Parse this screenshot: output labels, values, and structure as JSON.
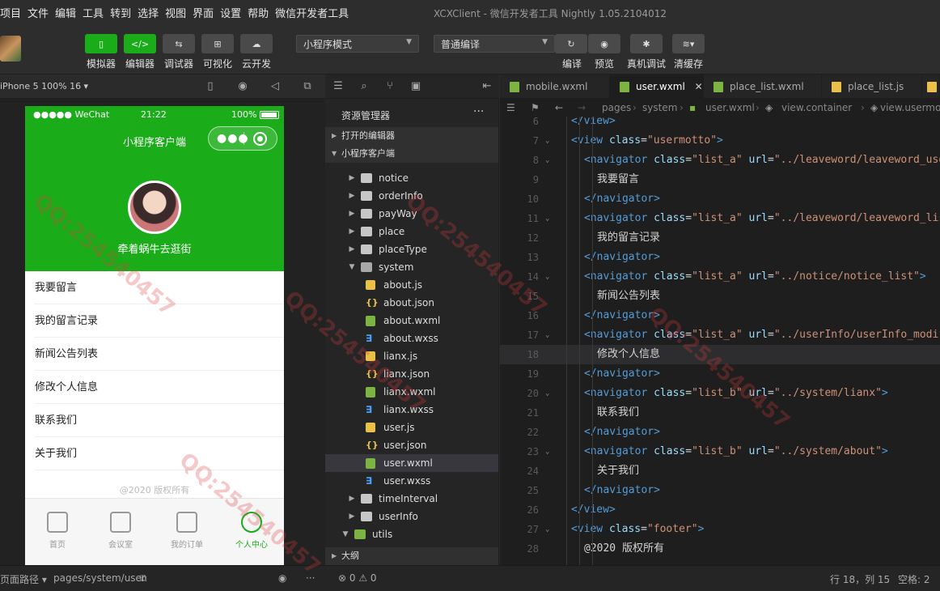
{
  "menubar": {
    "items": [
      "项目",
      "文件",
      "编辑",
      "工具",
      "转到",
      "选择",
      "视图",
      "界面",
      "设置",
      "帮助",
      "微信开发者工具"
    ],
    "title": "XCXClient - 微信开发者工具 Nightly 1.05.2104012"
  },
  "toolbar": {
    "buttons": [
      {
        "label": "模拟器",
        "icon": "phone-icon"
      },
      {
        "label": "编辑器",
        "icon": "code-icon"
      },
      {
        "label": "调试器",
        "icon": "debug-icon"
      },
      {
        "label": "可视化",
        "icon": "layout-icon"
      },
      {
        "label": "云开发",
        "icon": "cloud-icon"
      }
    ],
    "mode_select": "小程序模式",
    "compile_select": "普通编译",
    "right_buttons": [
      {
        "label": "编译",
        "icon": "refresh-icon"
      },
      {
        "label": "预览",
        "icon": "eye-icon"
      },
      {
        "label": "真机调试",
        "icon": "bug-icon"
      },
      {
        "label": "清缓存",
        "icon": "layers-icon"
      }
    ]
  },
  "simulator": {
    "device": "iPhone 5 100% 16 ▾",
    "status": {
      "carrier": "●●●●● WeChat",
      "time": "21:22",
      "battery": "100%"
    },
    "nav_title": "小程序客户端",
    "username": "牵着蜗牛去逛街",
    "menu_items": [
      "我要留言",
      "我的留言记录",
      "新闻公告列表",
      "修改个人信息",
      "联系我们",
      "关于我们"
    ],
    "footer": "@2020 版权所有",
    "tabs": [
      {
        "label": "首页",
        "active": false
      },
      {
        "label": "会议室",
        "active": false
      },
      {
        "label": "我的订单",
        "active": false
      },
      {
        "label": "个人中心",
        "active": true
      }
    ]
  },
  "explorer": {
    "title": "资源管理器",
    "open_editors": "打开的编辑器",
    "project": "小程序客户端",
    "outline": "大纲",
    "tree": [
      {
        "name": "notice",
        "type": "folder",
        "level": 1
      },
      {
        "name": "orderInfo",
        "type": "folder",
        "level": 1
      },
      {
        "name": "payWay",
        "type": "folder",
        "level": 1
      },
      {
        "name": "place",
        "type": "folder",
        "level": 1
      },
      {
        "name": "placeType",
        "type": "folder",
        "level": 1
      },
      {
        "name": "system",
        "type": "folder-open",
        "level": 1
      },
      {
        "name": "about.js",
        "type": "js",
        "level": 2
      },
      {
        "name": "about.json",
        "type": "json",
        "level": 2
      },
      {
        "name": "about.wxml",
        "type": "wxml",
        "level": 2
      },
      {
        "name": "about.wxss",
        "type": "wxss",
        "level": 2
      },
      {
        "name": "lianx.js",
        "type": "js",
        "level": 2
      },
      {
        "name": "lianx.json",
        "type": "json",
        "level": 2
      },
      {
        "name": "lianx.wxml",
        "type": "wxml",
        "level": 2
      },
      {
        "name": "lianx.wxss",
        "type": "wxss",
        "level": 2
      },
      {
        "name": "user.js",
        "type": "js",
        "level": 2
      },
      {
        "name": "user.json",
        "type": "json",
        "level": 2
      },
      {
        "name": "user.wxml",
        "type": "wxml",
        "level": 2,
        "selected": true
      },
      {
        "name": "user.wxss",
        "type": "wxss",
        "level": 2
      },
      {
        "name": "timeInterval",
        "type": "folder",
        "level": 1
      },
      {
        "name": "userInfo",
        "type": "folder",
        "level": 1
      },
      {
        "name": "utils",
        "type": "folder-green",
        "level": 0
      }
    ]
  },
  "editor": {
    "tabs": [
      {
        "label": "mobile.wxml",
        "icon": "wxml"
      },
      {
        "label": "user.wxml",
        "icon": "wxml",
        "active": true
      },
      {
        "label": "place_list.wxml",
        "icon": "wxml"
      },
      {
        "label": "place_list.js",
        "icon": "js"
      }
    ],
    "breadcrumb": [
      "pages",
      "system",
      "user.wxml",
      "view.container",
      "view.usermotto"
    ],
    "lines": [
      {
        "n": "6",
        "indent": 0,
        "html": "<span class='tag'>&lt;/view&gt;</span>"
      },
      {
        "n": "7",
        "indent": 0,
        "fold": true,
        "html": "<span class='tag'>&lt;view</span> <span class='attr'>class</span>=<span class='str'>\"usermotto\"</span><span class='tag'>&gt;</span>"
      },
      {
        "n": "8",
        "indent": 1,
        "fold": true,
        "html": "<span class='tag'>&lt;navigator</span> <span class='attr'>class</span>=<span class='str'>\"list_a\"</span> <span class='attr'>url</span>=<span class='str'>\"../leaveword/leaveword_user</span>"
      },
      {
        "n": "9",
        "indent": 2,
        "html": "<span class='txt'>我要留言</span>"
      },
      {
        "n": "10",
        "indent": 1,
        "html": "<span class='tag'>&lt;/navigator&gt;</span>"
      },
      {
        "n": "11",
        "indent": 1,
        "fold": true,
        "html": "<span class='tag'>&lt;navigator</span> <span class='attr'>class</span>=<span class='str'>\"list_a\"</span> <span class='attr'>url</span>=<span class='str'>\"../leaveword/leaveword_list</span>"
      },
      {
        "n": "12",
        "indent": 2,
        "html": "<span class='txt'>我的留言记录</span>"
      },
      {
        "n": "13",
        "indent": 1,
        "html": "<span class='tag'>&lt;/navigator&gt;</span>"
      },
      {
        "n": "14",
        "indent": 1,
        "fold": true,
        "html": "<span class='tag'>&lt;navigator</span> <span class='attr'>class</span>=<span class='str'>\"list_a\"</span> <span class='attr'>url</span>=<span class='str'>\"../notice/notice_list\"</span><span class='tag'>&gt;</span>"
      },
      {
        "n": "15",
        "indent": 2,
        "html": "<span class='txt'>新闻公告列表</span>"
      },
      {
        "n": "16",
        "indent": 1,
        "html": "<span class='tag'>&lt;/navigator&gt;</span>"
      },
      {
        "n": "17",
        "indent": 1,
        "fold": true,
        "html": "<span class='tag'>&lt;navigator</span> <span class='attr'>class</span>=<span class='str'>\"list_a\"</span> <span class='attr'>url</span>=<span class='str'>\"../userInfo/userInfo_modif</span>"
      },
      {
        "n": "18",
        "indent": 2,
        "hl": true,
        "html": "<span class='txt'>修改个人信息</span>"
      },
      {
        "n": "19",
        "indent": 1,
        "html": "<span class='tag'>&lt;/navigator&gt;</span>"
      },
      {
        "n": "20",
        "indent": 1,
        "fold": true,
        "html": "<span class='tag'>&lt;navigator</span> <span class='attr'>class</span>=<span class='str'>\"list_b\"</span> <span class='attr'>url</span>=<span class='str'>\"../system/lianx\"</span><span class='tag'>&gt;</span>"
      },
      {
        "n": "21",
        "indent": 2,
        "html": "<span class='txt'>联系我们</span>"
      },
      {
        "n": "22",
        "indent": 1,
        "html": "<span class='tag'>&lt;/navigator&gt;</span>"
      },
      {
        "n": "23",
        "indent": 1,
        "fold": true,
        "html": "<span class='tag'>&lt;navigator</span> <span class='attr'>class</span>=<span class='str'>\"list_b\"</span> <span class='attr'>url</span>=<span class='str'>\"../system/about\"</span><span class='tag'>&gt;</span>"
      },
      {
        "n": "24",
        "indent": 2,
        "html": "<span class='txt'>关于我们</span>"
      },
      {
        "n": "25",
        "indent": 1,
        "html": "<span class='tag'>&lt;/navigator&gt;</span>"
      },
      {
        "n": "26",
        "indent": 0,
        "html": "<span class='tag'>&lt;/view&gt;</span>"
      },
      {
        "n": "27",
        "indent": 0,
        "fold": true,
        "html": "<span class='tag'>&lt;view</span> <span class='attr'>class</span>=<span class='str'>\"footer\"</span><span class='tag'>&gt;</span>"
      },
      {
        "n": "28",
        "indent": 1,
        "html": "<span class='txt'>@2020 版权所有</span>"
      }
    ]
  },
  "statusbar": {
    "page_path_label": "页面路径 ▾",
    "page_path": "pages/system/user",
    "problems": "⊗ 0 ⚠ 0",
    "cursor": "行 18，列 15",
    "spaces": "空格: 2"
  }
}
